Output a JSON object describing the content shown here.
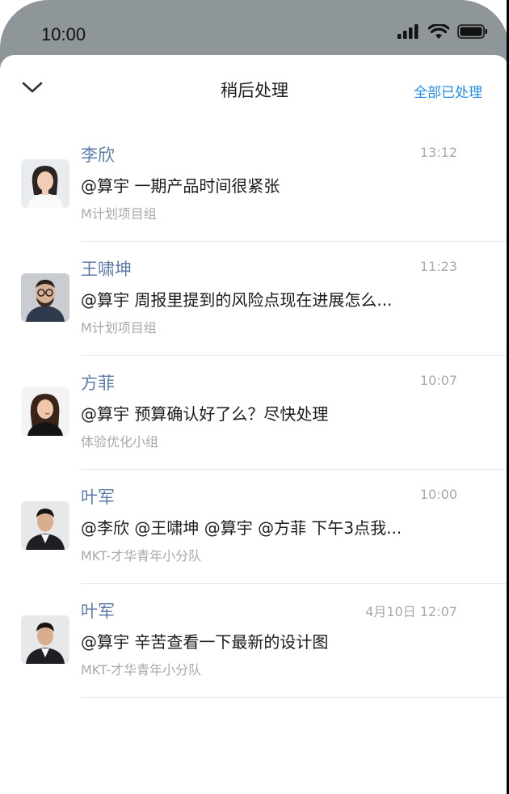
{
  "status_bar": {
    "time": "10:00",
    "icons": [
      "signal-icon",
      "wifi-icon",
      "battery-icon"
    ]
  },
  "header": {
    "back_icon": "chevron-down-icon",
    "title": "稍后处理",
    "action_label": "全部已处理"
  },
  "colors": {
    "accent": "#1f8ef1",
    "name_color": "#5a7ba8",
    "frame": "#8f9699",
    "secondary_text": "#a6a9ad"
  },
  "items": [
    {
      "name": "李欣",
      "time": "13:12",
      "message": "@算宇 一期产品时间很紧张",
      "group": "M计划项目组",
      "avatar": "woman-avatar-white"
    },
    {
      "name": "王啸坤",
      "time": "11:23",
      "message": "@算宇 周报里提到的风险点现在进展怎么...",
      "group": "M计划项目组",
      "avatar": "man-avatar-glasses"
    },
    {
      "name": "方菲",
      "time": "10:07",
      "message": "@算宇 预算确认好了么？尽快处理",
      "group": "体验优化小组",
      "avatar": "woman-avatar-black"
    },
    {
      "name": "叶军",
      "time": "10:00",
      "message": "@李欣 @王啸坤 @算宇 @方菲 下午3点我...",
      "group": "MKT-才华青年小分队",
      "avatar": "man-avatar-suit"
    },
    {
      "name": "叶军",
      "time": "4月10日 12:07",
      "message": "@算宇 辛苦查看一下最新的设计图",
      "group": "MKT-才华青年小分队",
      "avatar": "man-avatar-suit"
    }
  ]
}
